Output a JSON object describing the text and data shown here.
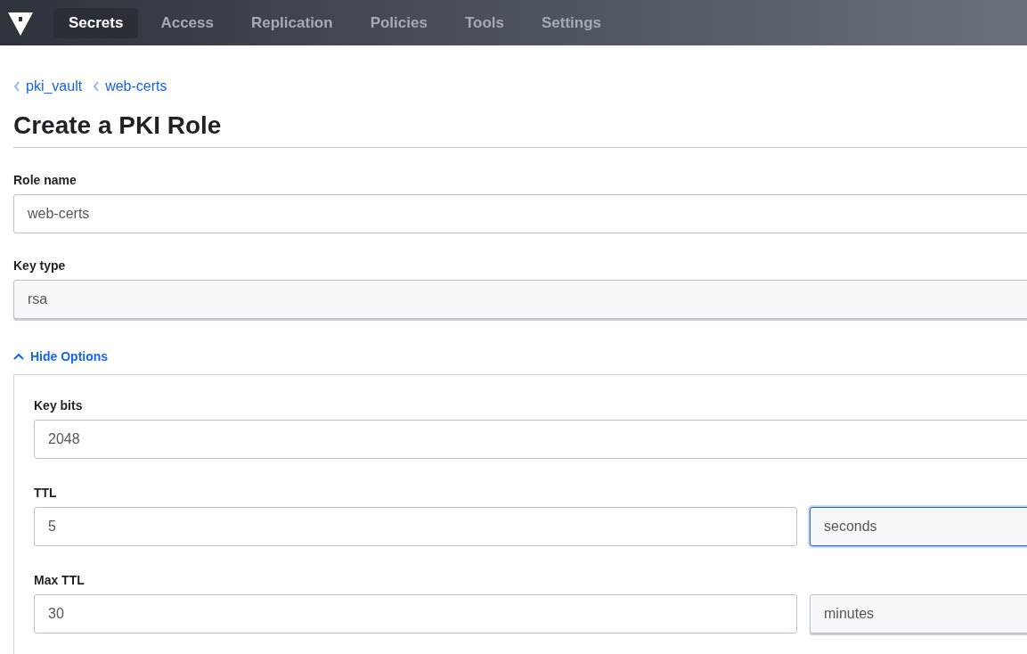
{
  "nav": {
    "items": [
      {
        "label": "Secrets",
        "selected": true
      },
      {
        "label": "Access",
        "selected": false
      },
      {
        "label": "Replication",
        "selected": false
      },
      {
        "label": "Policies",
        "selected": false
      },
      {
        "label": "Tools",
        "selected": false
      },
      {
        "label": "Settings",
        "selected": false
      }
    ]
  },
  "breadcrumbs": [
    "pki_vault",
    "web-certs"
  ],
  "title": "Create a PKI Role",
  "fields": [
    {
      "kind": "text",
      "label": "Role name",
      "value": "web-certs"
    },
    {
      "kind": "select",
      "label": "Key type",
      "value": "rsa"
    }
  ],
  "options_toggle": {
    "label": "Hide Options",
    "expanded": true
  },
  "options_fields": [
    {
      "kind": "text",
      "label": "Key bits",
      "value": "2048"
    },
    {
      "kind": "ttl",
      "label": "TTL",
      "value": "5",
      "unit": "seconds",
      "unit_focused": true
    },
    {
      "kind": "ttl",
      "label": "Max TTL",
      "value": "30",
      "unit": "minutes",
      "unit_focused": false
    }
  ]
}
